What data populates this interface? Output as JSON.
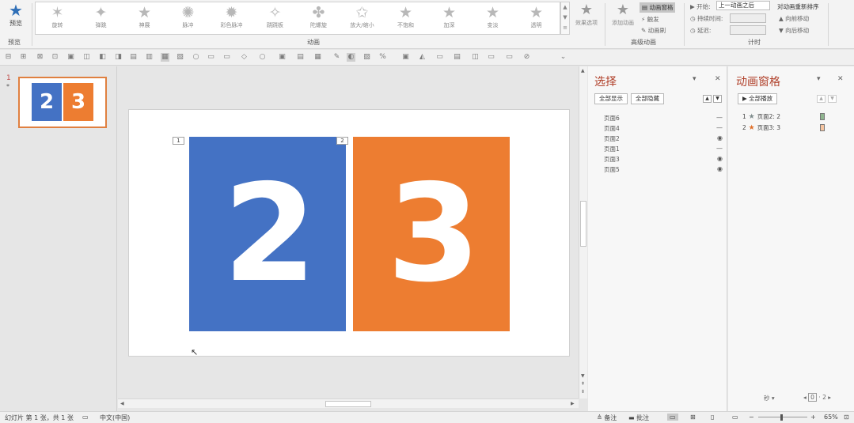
{
  "ribbon": {
    "preview_group": {
      "button_label": "预览",
      "group_label": "预览"
    },
    "animation_group_label": "动画",
    "animations": [
      "旋转",
      "弹跳",
      "神展",
      "脉冲",
      "彩色脉冲",
      "跷跷板",
      "陀螺旋",
      "放大/缩小",
      "不饱和",
      "加深",
      "变淡",
      "透明"
    ],
    "effect_options_label": "效果选项",
    "add_animation_label": "添加动画",
    "animation_pane_label": "动画窗格",
    "trigger_label": "触发",
    "animation_painter_label": "动画刷",
    "advanced_group_label": "高级动画",
    "start_label": "开始:",
    "start_value": "上一动画之后",
    "duration_label": "持续时间:",
    "delay_label": "延迟:",
    "reorder_title": "对动画重新排序",
    "move_earlier": "向前移动",
    "move_later": "向后移动",
    "timing_group_label": "计时"
  },
  "thumbnails": [
    {
      "number": "1",
      "marker": "*",
      "left_digit": "2",
      "right_digit": "3"
    }
  ],
  "slide": {
    "cards": [
      {
        "text": "2",
        "tag": "1",
        "color": "#4472c4"
      },
      {
        "text": "3",
        "tag": "2",
        "color": "#ed7d31"
      }
    ]
  },
  "selection_pane": {
    "title": "选择",
    "show_all": "全部显示",
    "hide_all": "全部隐藏",
    "items": [
      {
        "name": "页面6",
        "visible": false
      },
      {
        "name": "页面4",
        "visible": false
      },
      {
        "name": "页面2",
        "visible": true
      },
      {
        "name": "页面1",
        "visible": false
      },
      {
        "name": "页面3",
        "visible": true
      },
      {
        "name": "页面5",
        "visible": true
      }
    ]
  },
  "animation_pane": {
    "title": "动画窗格",
    "play_all": "全部播放",
    "items": [
      {
        "index": "1",
        "label": "页面2: 2",
        "star_color": "#7f8c8d",
        "bar_color": "#8fb58f"
      },
      {
        "index": "2",
        "label": "页面3: 3",
        "star_color": "#e0702a",
        "bar_color": "#f5c4a0"
      }
    ],
    "seconds_label": "秒",
    "zoom_start": "0",
    "zoom_end": "2"
  },
  "status_bar": {
    "slide_info": "幻灯片 第 1 张，共 1 张",
    "language": "中文(中国)",
    "notes": "备注",
    "comments": "批注",
    "zoom": "65%"
  },
  "colors": {
    "accent": "#b0402a",
    "blue": "#4472c4",
    "orange": "#ed7d31"
  }
}
